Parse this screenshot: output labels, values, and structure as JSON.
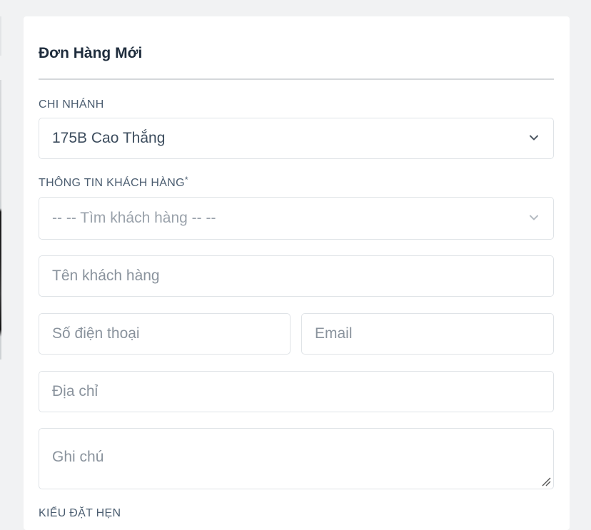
{
  "form": {
    "title": "Đơn Hàng Mới",
    "branch_label": "CHI NHÁNH",
    "branch_value": "175B Cao Thắng",
    "customer_label": "THÔNG TIN KHÁCH HÀNG",
    "required_mark": "*",
    "customer_search_placeholder": "-- -- Tìm khách hàng -- --",
    "customer_name_placeholder": "Tên khách hàng",
    "phone_placeholder": "Số điện thoại",
    "email_placeholder": "Email",
    "address_placeholder": "Địa chỉ",
    "note_placeholder": "Ghi chú",
    "appointment_label": "KIỂU ĐẶT HẸN"
  },
  "icons": {
    "chevron": "chevron-down-icon",
    "resize": "resize-handle-icon"
  },
  "colors": {
    "page_bg": "#f1f2f3",
    "card_bg": "#ffffff",
    "title": "#1f2d3d",
    "label": "#4b5d70",
    "border": "#dfe3e7",
    "placeholder": "#8a939d"
  }
}
